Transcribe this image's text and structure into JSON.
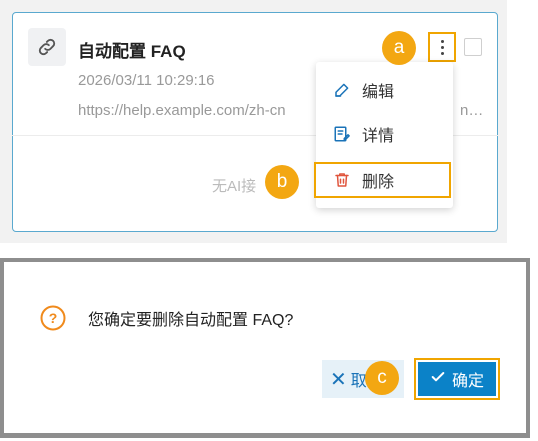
{
  "card": {
    "title": "自动配置 FAQ",
    "time": "2026/03/11 10:29:16",
    "url": "https://help.example.com/zh-cn",
    "url_tail": "n…",
    "empty_text": "无AI接"
  },
  "menu": {
    "edit_label": "编辑",
    "detail_label": "详情",
    "delete_label": "删除"
  },
  "badges": {
    "a": "a",
    "b": "b",
    "c": "c"
  },
  "dialog": {
    "message": "您确定要删除自动配置 FAQ?",
    "cancel_label": "取",
    "confirm_label": "确定"
  },
  "colors": {
    "highlight": "#f0a500",
    "badge": "#f3a712",
    "primary": "#0b82c8",
    "card_border": "#5aa9cf",
    "delete_icon": "#e0553d",
    "question_icon": "#f08a1c"
  },
  "icons": {
    "link": "link-icon",
    "more": "more-vertical-icon",
    "edit": "pencil-icon",
    "detail": "detail-icon",
    "delete": "trash-icon",
    "question": "question-circle-icon",
    "cancel": "close-icon",
    "confirm": "check-icon"
  }
}
